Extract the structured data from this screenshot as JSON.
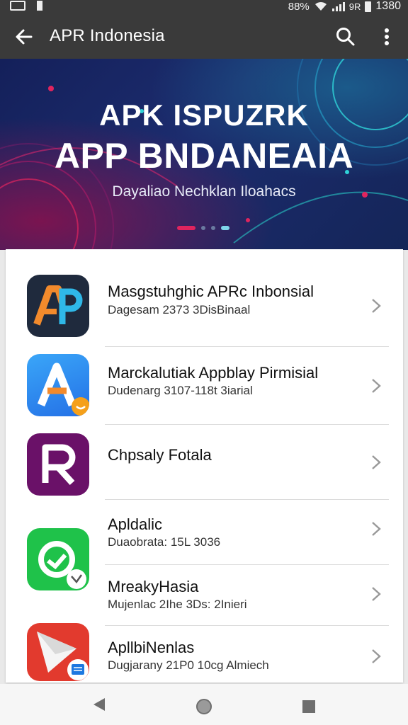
{
  "status_bar": {
    "signal_text": "88%",
    "carrier": "9R",
    "time": "1380",
    "icons": [
      "image-icon",
      "notification-dot-icon",
      "wifi-icon",
      "signal-icon",
      "battery-icon"
    ]
  },
  "app_bar": {
    "title": "APR Indonesia",
    "icons": [
      "back-arrow-icon",
      "search-icon",
      "more-vert-icon"
    ]
  },
  "banner": {
    "line1": "APK ISPUZRK",
    "line2": "APP BNDANEAIA",
    "subtitle": "Dayaliao Nechklan Iloahacs",
    "carousel_pages": 4,
    "active_page": 0
  },
  "apps": [
    {
      "name": "Masgstuhghic APRc Inbonsial",
      "subtitle": "Dagesam 2373 3DisBinaal",
      "icon": "ap-logo-icon",
      "icon_text": "AP",
      "icon_bg": "#1f2a3d"
    },
    {
      "name": "Marckalutiak Appblay Pirmisial",
      "subtitle": "Dudenarg 3107-118t 3iarial",
      "icon": "a-logo-icon",
      "icon_text": "A",
      "icon_bg": "#2e8ef0"
    },
    {
      "name": "Chpsaly Fotala",
      "subtitle": "",
      "icon": "r-logo-icon",
      "icon_text": "R",
      "icon_bg": "#6a1168"
    },
    {
      "name": "Apldalic",
      "subtitle": "Duaobrata: 15L 3036",
      "icon": "green-sync-icon",
      "icon_text": "",
      "icon_bg": "#1fc24a"
    },
    {
      "name": "MreakyHasia",
      "subtitle": "Mujenlac 2Ihe 3Ds: 2Inieri",
      "icon": "",
      "icon_text": "",
      "icon_bg": ""
    },
    {
      "name": "ApllbiNenlas",
      "subtitle": "Dugjarany 21P0 10cg Almiech",
      "icon": "red-play-icon",
      "icon_text": "",
      "icon_bg": "#e23a2e"
    }
  ],
  "nav_bar": {
    "icons": [
      "nav-back-icon",
      "nav-home-icon",
      "nav-recents-icon"
    ]
  }
}
